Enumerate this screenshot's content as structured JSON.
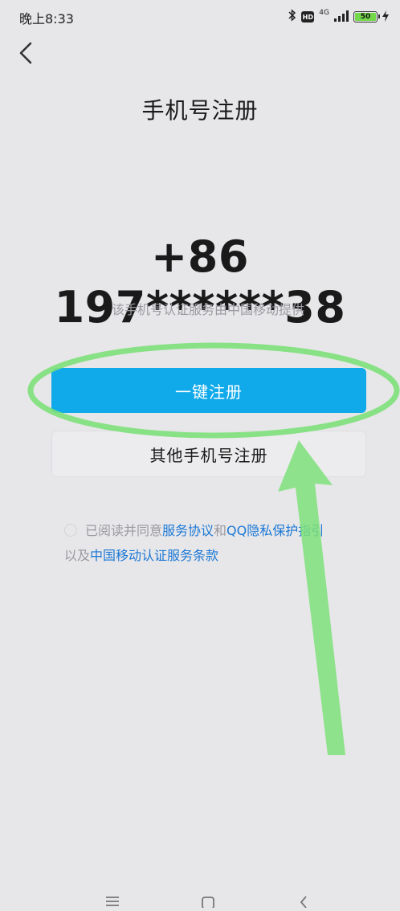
{
  "status_bar": {
    "time": "晚上8:33",
    "network": "4G",
    "battery": "50",
    "icons": [
      "bluetooth-icon",
      "hd-icon",
      "signal-icon",
      "battery-icon",
      "charging-icon"
    ]
  },
  "header": {
    "back_icon": "chevron-left-icon",
    "title": "手机号注册"
  },
  "main": {
    "phone_number": "+86 197******38",
    "auth_note": "该手机号认证服务由中国移动提供",
    "primary_button": "一键注册",
    "secondary_button": "其他手机号注册"
  },
  "agreement": {
    "prefix": "已阅读并同意",
    "link_service": "服务协议",
    "conjunction": "和",
    "link_privacy": "QQ隐私保护指引",
    "line2_prefix": "以及",
    "link_cmcc": "中国移动认证服务条款"
  },
  "nav_bar": {
    "icons": [
      "menu-icon",
      "home-icon",
      "back-icon"
    ]
  },
  "colors": {
    "background": "#e7e7e9",
    "primary_button": "#10a9ea",
    "link": "#1c78d6",
    "annotation_green": "#7ee07a"
  }
}
